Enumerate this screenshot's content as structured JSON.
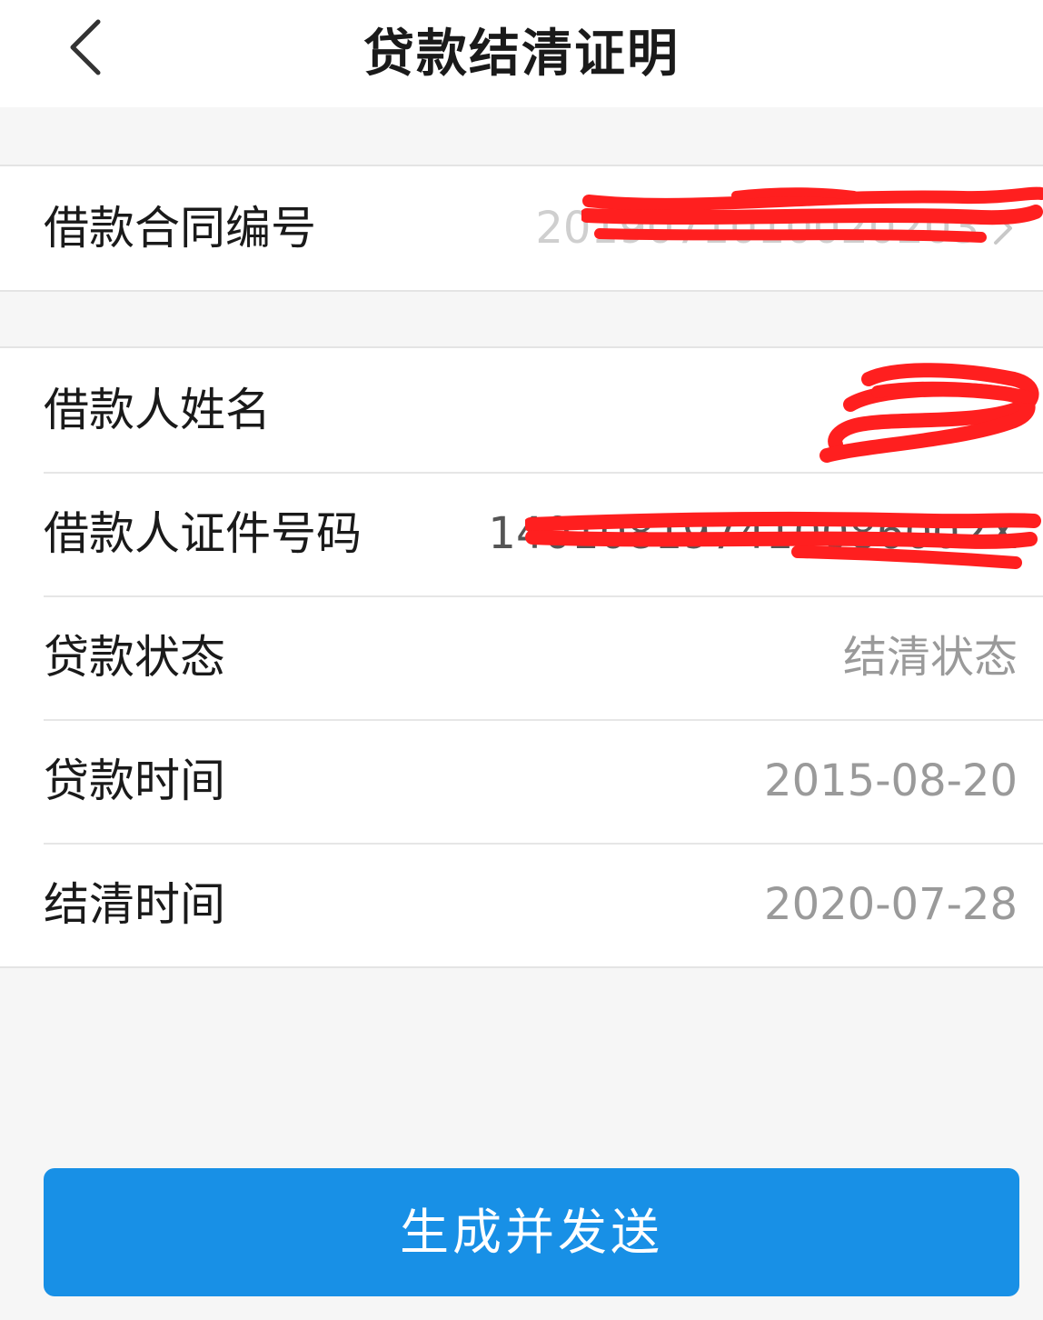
{
  "nav": {
    "title": "贷款结清证明",
    "back_icon": "chevron-left-icon"
  },
  "contract": {
    "label": "借款合同编号",
    "value": "2019071010020203",
    "redacted": true,
    "arrow_icon": "chevron-right-icon"
  },
  "details": {
    "rows": [
      {
        "label": "借款人姓名",
        "value": "",
        "redacted": true
      },
      {
        "label": "借款人证件号码",
        "value": "140108197410086002X",
        "redacted": true
      },
      {
        "label": "贷款状态",
        "value": "结清状态"
      },
      {
        "label": "贷款时间",
        "value": "2015-08-20"
      },
      {
        "label": "结清时间",
        "value": "2020-07-28"
      }
    ]
  },
  "button": {
    "label": "生成并发送"
  },
  "colors": {
    "accent": "#1890e6",
    "redaction": "#ff1f1f",
    "background": "#f6f6f6"
  }
}
